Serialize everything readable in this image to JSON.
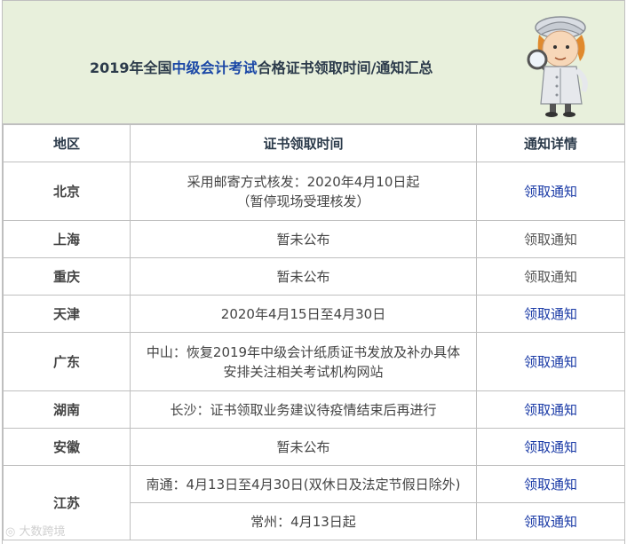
{
  "header": {
    "title_prefix": "2019年全国",
    "title_highlight": "中级会计考试",
    "title_suffix": "合格证书领取时间/通知汇总"
  },
  "table": {
    "headers": [
      "地区",
      "证书领取时间",
      "通知详情"
    ],
    "rows": [
      {
        "region": "北京",
        "time_line1": "采用邮寄方式核发：2020年4月10日起",
        "time_line2": "（暂停现场受理核发）",
        "notice": "领取通知",
        "notice_link": true
      },
      {
        "region": "上海",
        "time_line1": "暂未公布",
        "time_line2": "",
        "notice": "领取通知",
        "notice_link": false
      },
      {
        "region": "重庆",
        "time_line1": "暂未公布",
        "time_line2": "",
        "notice": "领取通知",
        "notice_link": false
      },
      {
        "region": "天津",
        "time_line1": "2020年4月15日至4月30日",
        "time_line2": "",
        "notice": "领取通知",
        "notice_link": true
      },
      {
        "region": "广东",
        "time_line1": "中山：恢复2019年中级会计纸质证书发放及补办具体",
        "time_line2": "安排关注相关考试机构网站",
        "notice": "领取通知",
        "notice_link": true
      },
      {
        "region": "湖南",
        "time_line1": "长沙：证书领取业务建议待疫情结束后再进行",
        "time_line2": "",
        "notice": "领取通知",
        "notice_link": true
      },
      {
        "region": "安徽",
        "time_line1": "暂未公布",
        "time_line2": "",
        "notice": "领取通知",
        "notice_link": true
      },
      {
        "region": "江苏",
        "time_line1": "南通：4月13日至4月30日(双休日及法定节假日除外)",
        "time_line2": "",
        "notice": "领取通知",
        "notice_link": true
      },
      {
        "region": "",
        "time_line1": "常州：4月13日起",
        "time_line2": "",
        "notice": "领取通知",
        "notice_link": true
      }
    ]
  },
  "watermark": "大数跨境",
  "colors": {
    "header_bg": "#e8f0dc",
    "link": "#1a3aa6",
    "highlight": "#1a47a6",
    "border": "#bfbfbf"
  },
  "icons": {
    "mascot": "detective-magnifier-character-icon"
  }
}
